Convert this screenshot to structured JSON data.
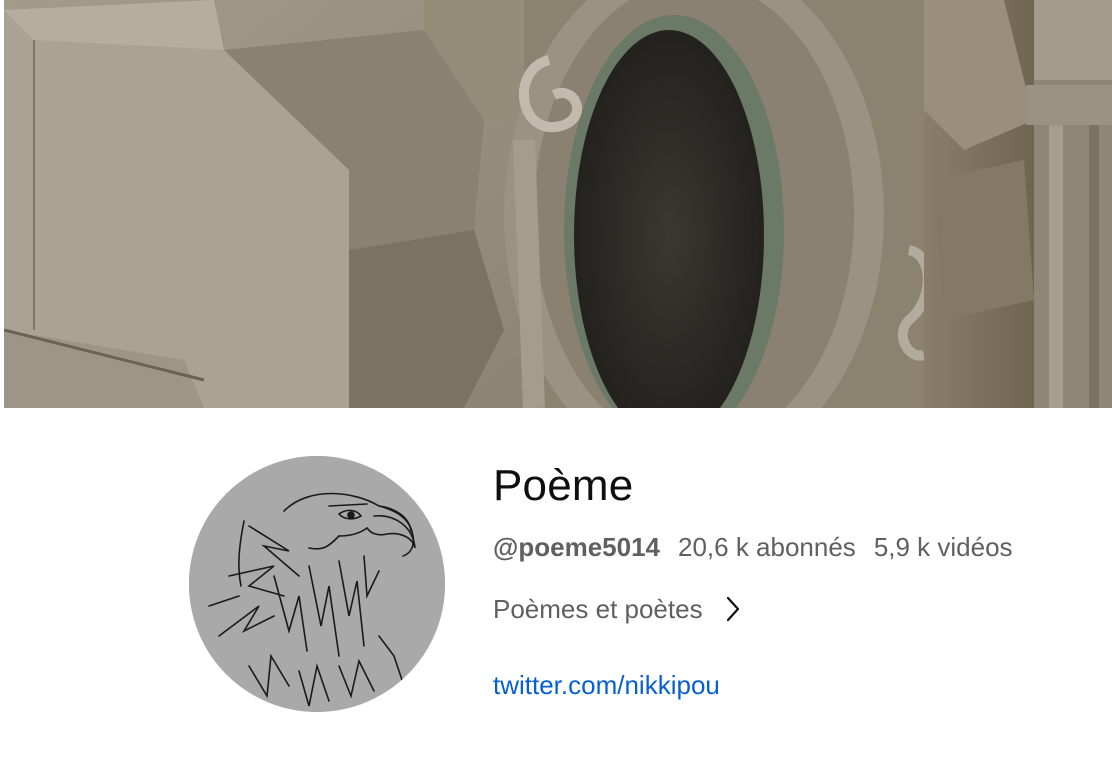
{
  "channel": {
    "title": "Poème",
    "handle": "@poeme5014",
    "subscribers": "20,6 k abonnés",
    "videos": "5,9 k vidéos",
    "description": "Poèmes et poètes",
    "link": "twitter.com/nikkipou"
  },
  "colors": {
    "link": "#065fd4",
    "secondary_text": "#606060",
    "primary_text": "#0f0f0f"
  },
  "icons": {
    "description_more": "chevron-right-icon"
  }
}
